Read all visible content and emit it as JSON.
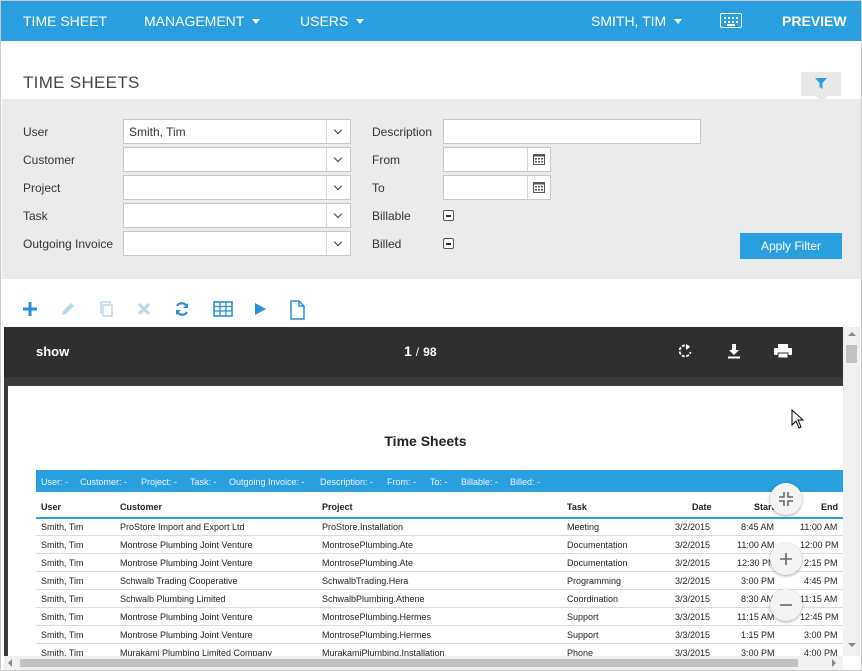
{
  "nav": {
    "timesheet": "TIME SHEET",
    "management": "MANAGEMENT",
    "users": "USERS",
    "current_user": "SMITH, TIM",
    "keyboard_icon": "keyboard-icon",
    "preview": "PREVIEW"
  },
  "page": {
    "title": "TIME SHEETS",
    "filter_icon": "funnel-icon"
  },
  "filters": {
    "user_label": "User",
    "user_value": "Smith, Tim",
    "customer_label": "Customer",
    "customer_value": "",
    "project_label": "Project",
    "project_value": "",
    "task_label": "Task",
    "task_value": "",
    "invoice_label": "Outgoing Invoice",
    "invoice_value": "",
    "description_label": "Description",
    "description_value": "",
    "from_label": "From",
    "from_value": "",
    "to_label": "To",
    "to_value": "",
    "billable_label": "Billable",
    "billed_label": "Billed",
    "apply_label": "Apply Filter"
  },
  "toolbar": {
    "icons": [
      "add-icon",
      "edit-icon",
      "copy-icon",
      "delete-icon",
      "refresh-icon",
      "grid-icon",
      "play-icon",
      "document-icon"
    ]
  },
  "viewer": {
    "show_label": "show",
    "current_page": "1",
    "page_sep": "/",
    "total_pages": "98",
    "icons": [
      "rotate-icon",
      "download-icon",
      "print-icon"
    ]
  },
  "report": {
    "title": "Time Sheets",
    "criteria": [
      "User: -",
      "Customer: -",
      "Project: -",
      "Task: -",
      "Outgoing Invoice: -",
      "Description: -",
      "From: -",
      "To: -",
      "Billable: -",
      "Billed: -"
    ],
    "columns": [
      "User",
      "Customer",
      "Project",
      "Task",
      "Date",
      "Start",
      "End"
    ],
    "rows": [
      [
        "Smith, Tim",
        "ProStore Import and Export Ltd",
        "ProStore.Installation",
        "Meeting",
        "3/2/2015",
        "8:45 AM",
        "11:00 AM"
      ],
      [
        "Smith, Tim",
        "Montrose Plumbing Joint Venture",
        "MontrosePlumbing.Ate",
        "Documentation",
        "3/2/2015",
        "11:00 AM",
        "12:00 PM"
      ],
      [
        "Smith, Tim",
        "Montrose Plumbing Joint Venture",
        "MontrosePlumbing.Ate",
        "Documentation",
        "3/2/2015",
        "12:30 PM",
        "2:15 PM"
      ],
      [
        "Smith, Tim",
        "Schwalb Trading Cooperative",
        "SchwalbTrading.Hera",
        "Programming",
        "3/2/2015",
        "3:00 PM",
        "4:45 PM"
      ],
      [
        "Smith, Tim",
        "Schwalb Plumbing Limited",
        "SchwalbPlumbing.Athene",
        "Coordination",
        "3/3/2015",
        "8:30 AM",
        "11:15 AM"
      ],
      [
        "Smith, Tim",
        "Montrose Plumbing Joint Venture",
        "MontrosePlumbing.Hermes",
        "Support",
        "3/3/2015",
        "11:15 AM",
        "12:45 PM"
      ],
      [
        "Smith, Tim",
        "Montrose Plumbing Joint Venture",
        "MontrosePlumbing.Hermes",
        "Support",
        "3/3/2015",
        "1:15 PM",
        "3:00 PM"
      ],
      [
        "Smith, Tim",
        "Murakami Plumbing Limited Company",
        "MurakamiPlumbing.Installation",
        "Phone",
        "3/3/2015",
        "3:00 PM",
        "4:00 PM"
      ]
    ]
  },
  "zoom": {
    "icons": [
      "fit-page-icon",
      "zoom-in-icon",
      "zoom-out-icon"
    ]
  }
}
